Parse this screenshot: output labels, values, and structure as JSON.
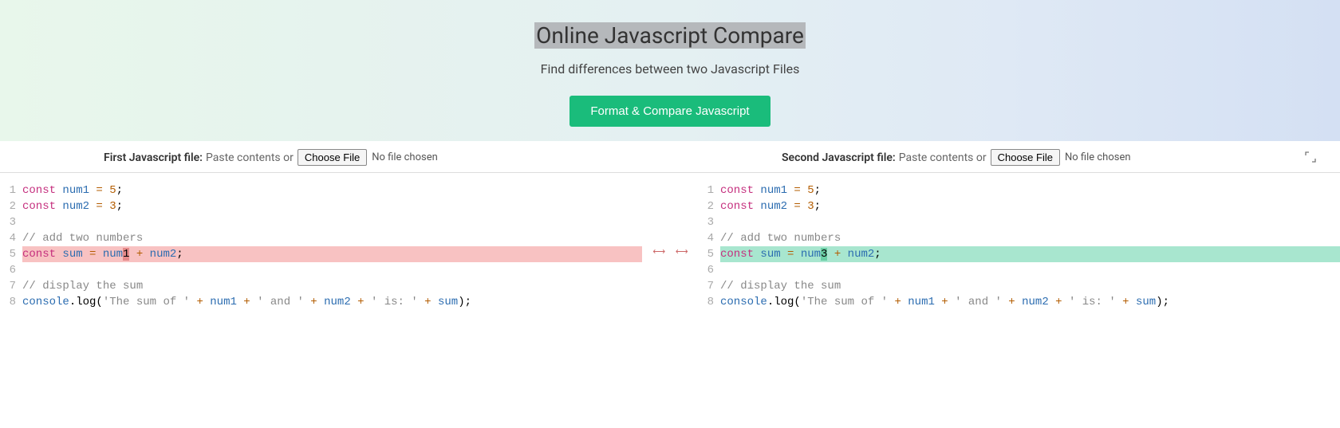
{
  "header": {
    "title": "Online Javascript Compare",
    "subtitle": "Find differences between two Javascript Files",
    "compare_button": "Format & Compare Javascript"
  },
  "file_bar": {
    "left": {
      "label": "First Javascript file:",
      "instruction": "Paste contents or",
      "choose_file": "Choose File",
      "no_file": "No file chosen"
    },
    "right": {
      "label": "Second Javascript file:",
      "instruction": "Paste contents or",
      "choose_file": "Choose File",
      "no_file": "No file chosen"
    }
  },
  "code": {
    "left": {
      "lines": [
        {
          "num": "1",
          "tokens": [
            [
              "kw",
              "const"
            ],
            [
              "",
              ""
            ],
            [
              "var",
              " num1"
            ],
            [
              "",
              ""
            ],
            [
              "op",
              " ="
            ],
            [
              "",
              ""
            ],
            [
              "num",
              " 5"
            ],
            [
              "",
              "; "
            ]
          ]
        },
        {
          "num": "2",
          "tokens": [
            [
              "kw",
              "const"
            ],
            [
              "var",
              " num2"
            ],
            [
              "op",
              " ="
            ],
            [
              "num",
              " 3"
            ],
            [
              "",
              "; "
            ]
          ]
        },
        {
          "num": "3",
          "tokens": []
        },
        {
          "num": "4",
          "tokens": [
            [
              "cmt",
              "// add two numbers"
            ]
          ]
        },
        {
          "num": "5",
          "diff": "removed",
          "tokens": [
            [
              "kw",
              "const"
            ],
            [
              "var",
              " sum"
            ],
            [
              "op",
              " ="
            ],
            [
              "",
              ""
            ],
            [
              "var",
              " num"
            ],
            [
              "chg-del",
              "1"
            ],
            [
              "op",
              " +"
            ],
            [
              "var",
              " num2"
            ],
            [
              "",
              "; "
            ]
          ]
        },
        {
          "num": "6",
          "tokens": []
        },
        {
          "num": "7",
          "tokens": [
            [
              "cmt",
              "// display the sum"
            ]
          ]
        },
        {
          "num": "8",
          "tokens": [
            [
              "var",
              "console"
            ],
            [
              "",
              ".log"
            ],
            [
              "",
              "("
            ],
            [
              "str",
              "'The sum of '"
            ],
            [
              "op",
              " +"
            ],
            [
              "var",
              " num1"
            ],
            [
              "op",
              " +"
            ],
            [
              "str",
              " ' and '"
            ],
            [
              "op",
              " +"
            ],
            [
              "var",
              " num2"
            ],
            [
              "op",
              " +"
            ],
            [
              "str",
              " ' is: '"
            ],
            [
              "op",
              " +"
            ],
            [
              "var",
              " sum"
            ],
            [
              "",
              ");"
            ]
          ]
        }
      ]
    },
    "right": {
      "lines": [
        {
          "num": "1",
          "tokens": [
            [
              "kw",
              "const"
            ],
            [
              "var",
              " num1"
            ],
            [
              "op",
              " ="
            ],
            [
              "num",
              " 5"
            ],
            [
              "",
              "; "
            ]
          ]
        },
        {
          "num": "2",
          "tokens": [
            [
              "kw",
              "const"
            ],
            [
              "var",
              " num2"
            ],
            [
              "op",
              " ="
            ],
            [
              "num",
              " 3"
            ],
            [
              "",
              "; "
            ]
          ]
        },
        {
          "num": "3",
          "tokens": []
        },
        {
          "num": "4",
          "tokens": [
            [
              "cmt",
              "// add two numbers"
            ]
          ]
        },
        {
          "num": "5",
          "diff": "added",
          "tokens": [
            [
              "kw",
              "const"
            ],
            [
              "var",
              " sum"
            ],
            [
              "op",
              " ="
            ],
            [
              "var",
              " num"
            ],
            [
              "chg-add",
              "3"
            ],
            [
              "op",
              " +"
            ],
            [
              "var",
              " num2"
            ],
            [
              "",
              "; "
            ]
          ]
        },
        {
          "num": "6",
          "tokens": []
        },
        {
          "num": "7",
          "tokens": [
            [
              "cmt",
              "// display the sum"
            ]
          ]
        },
        {
          "num": "8",
          "tokens": [
            [
              "var",
              "console"
            ],
            [
              "",
              ".log"
            ],
            [
              "",
              "("
            ],
            [
              "str",
              "'The sum of '"
            ],
            [
              "op",
              " +"
            ],
            [
              "var",
              " num1"
            ],
            [
              "op",
              " +"
            ],
            [
              "str",
              " ' and '"
            ],
            [
              "op",
              " +"
            ],
            [
              "var",
              " num2"
            ],
            [
              "op",
              " +"
            ],
            [
              "str",
              " ' is: '"
            ],
            [
              "op",
              " +"
            ],
            [
              "var",
              " sum"
            ],
            [
              "",
              ");"
            ]
          ]
        }
      ]
    }
  },
  "gutter_marker": "⟷"
}
